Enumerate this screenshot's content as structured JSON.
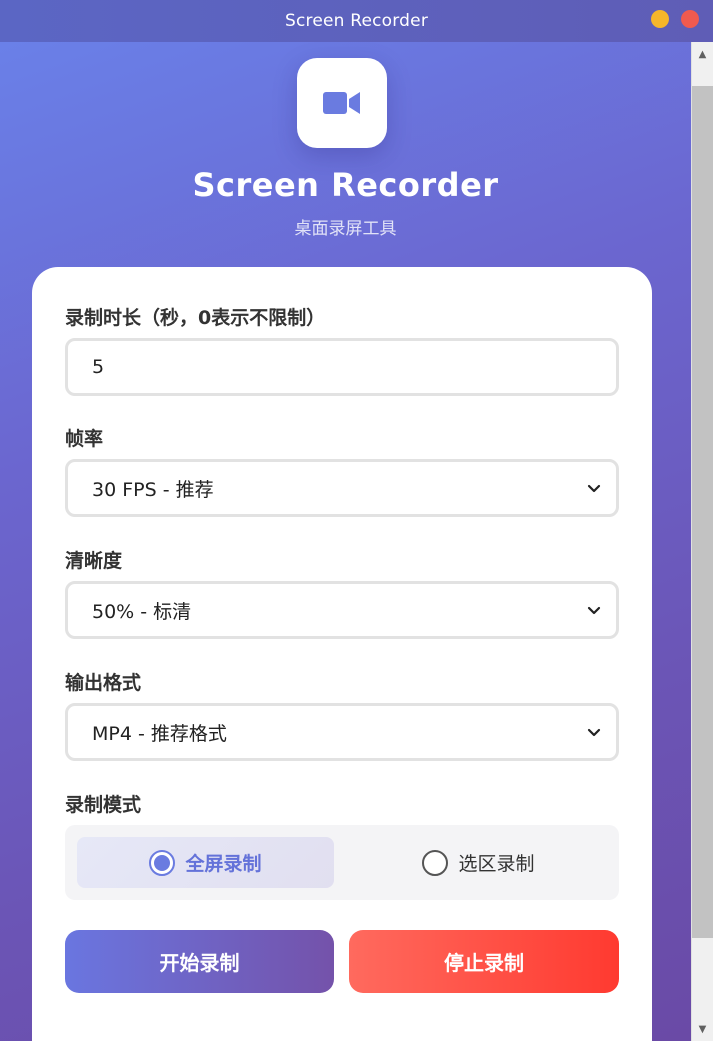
{
  "window": {
    "title": "Screen Recorder"
  },
  "header": {
    "app_icon": "video-camera-icon",
    "title": "Screen Recorder",
    "subtitle": "桌面录屏工具"
  },
  "form": {
    "duration": {
      "label": "录制时长（秒，0表示不限制）",
      "value": "5"
    },
    "fps": {
      "label": "帧率",
      "selected": "30 FPS - 推荐"
    },
    "quality": {
      "label": "清晰度",
      "selected": "50% - 标清"
    },
    "format": {
      "label": "输出格式",
      "selected": "MP4 - 推荐格式"
    },
    "mode": {
      "label": "录制模式",
      "options": [
        {
          "label": "全屏录制",
          "selected": true
        },
        {
          "label": "选区录制",
          "selected": false
        }
      ]
    }
  },
  "actions": {
    "start_label": "开始录制",
    "stop_label": "停止录制"
  },
  "colors": {
    "accent": "#6a7be0",
    "stop_red": "#ff3a30",
    "min_dot": "#f6b62a",
    "close_dot": "#f05a4f"
  }
}
